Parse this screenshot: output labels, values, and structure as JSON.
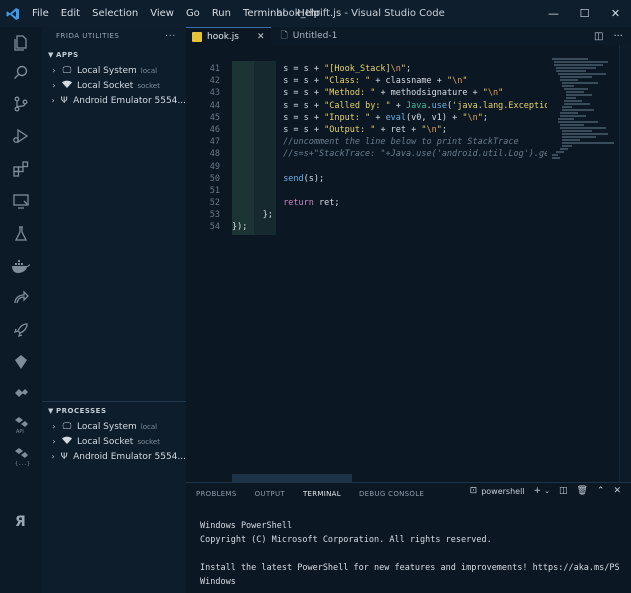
{
  "titlebar": {
    "menu": [
      "File",
      "Edit",
      "Selection",
      "View",
      "Go",
      "Run",
      "Terminal",
      "Help"
    ],
    "window_title": "hook_thrift.js - Visual Studio Code",
    "controls": {
      "minimize": "—",
      "maximize": "☐",
      "close": "✕"
    }
  },
  "activity_icons": [
    "explorer-icon",
    "search-icon",
    "source-control-icon",
    "run-debug-icon",
    "extensions-icon",
    "remote-explorer-icon",
    "testing-icon",
    "docker-icon",
    "live-share-icon",
    "rocket-icon",
    "frida-icon",
    "api-icon",
    "json-icon",
    "frida-r-icon"
  ],
  "sidebar": {
    "title": "FRIDA UTILITIES",
    "more": "···",
    "apps": {
      "header": "APPS",
      "items": [
        {
          "label": "Local System",
          "desc": "local",
          "icon": "monitor-icon"
        },
        {
          "label": "Local Socket",
          "desc": "socket",
          "icon": "wifi-icon"
        },
        {
          "label": "Android Emulator 5554...",
          "desc": "",
          "icon": "usb-icon"
        }
      ]
    },
    "processes": {
      "header": "PROCESSES",
      "items": [
        {
          "label": "Local System",
          "desc": "local",
          "icon": "monitor-icon"
        },
        {
          "label": "Local Socket",
          "desc": "socket",
          "icon": "wifi-icon"
        },
        {
          "label": "Android Emulator 5554...",
          "desc": "",
          "icon": "usb-icon"
        }
      ]
    }
  },
  "tabs": [
    {
      "label": "hook.js",
      "active": true,
      "close": "✕"
    },
    {
      "label": "Untitled-1",
      "active": false
    }
  ],
  "editor": {
    "line_numbers": [
      "41",
      "42",
      "43",
      "44",
      "45",
      "46",
      "47",
      "48",
      "49",
      "50",
      "51",
      "52",
      "53",
      "54"
    ]
  },
  "panel": {
    "tabs": [
      "PROBLEMS",
      "OUTPUT",
      "TERMINAL",
      "DEBUG CONSOLE"
    ],
    "active_tab": "TERMINAL",
    "shell": "powershell",
    "terminal_lines": [
      "Windows PowerShell",
      "Copyright (C) Microsoft Corporation. All rights reserved.",
      "",
      "Install the latest PowerShell for new features and improvements! https://aka.ms/PS",
      "Windows"
    ]
  },
  "colors": {
    "accent": "#3a6ea5",
    "background": "#0b1723",
    "string": "#e7d36c",
    "function": "#6fb1e8"
  }
}
